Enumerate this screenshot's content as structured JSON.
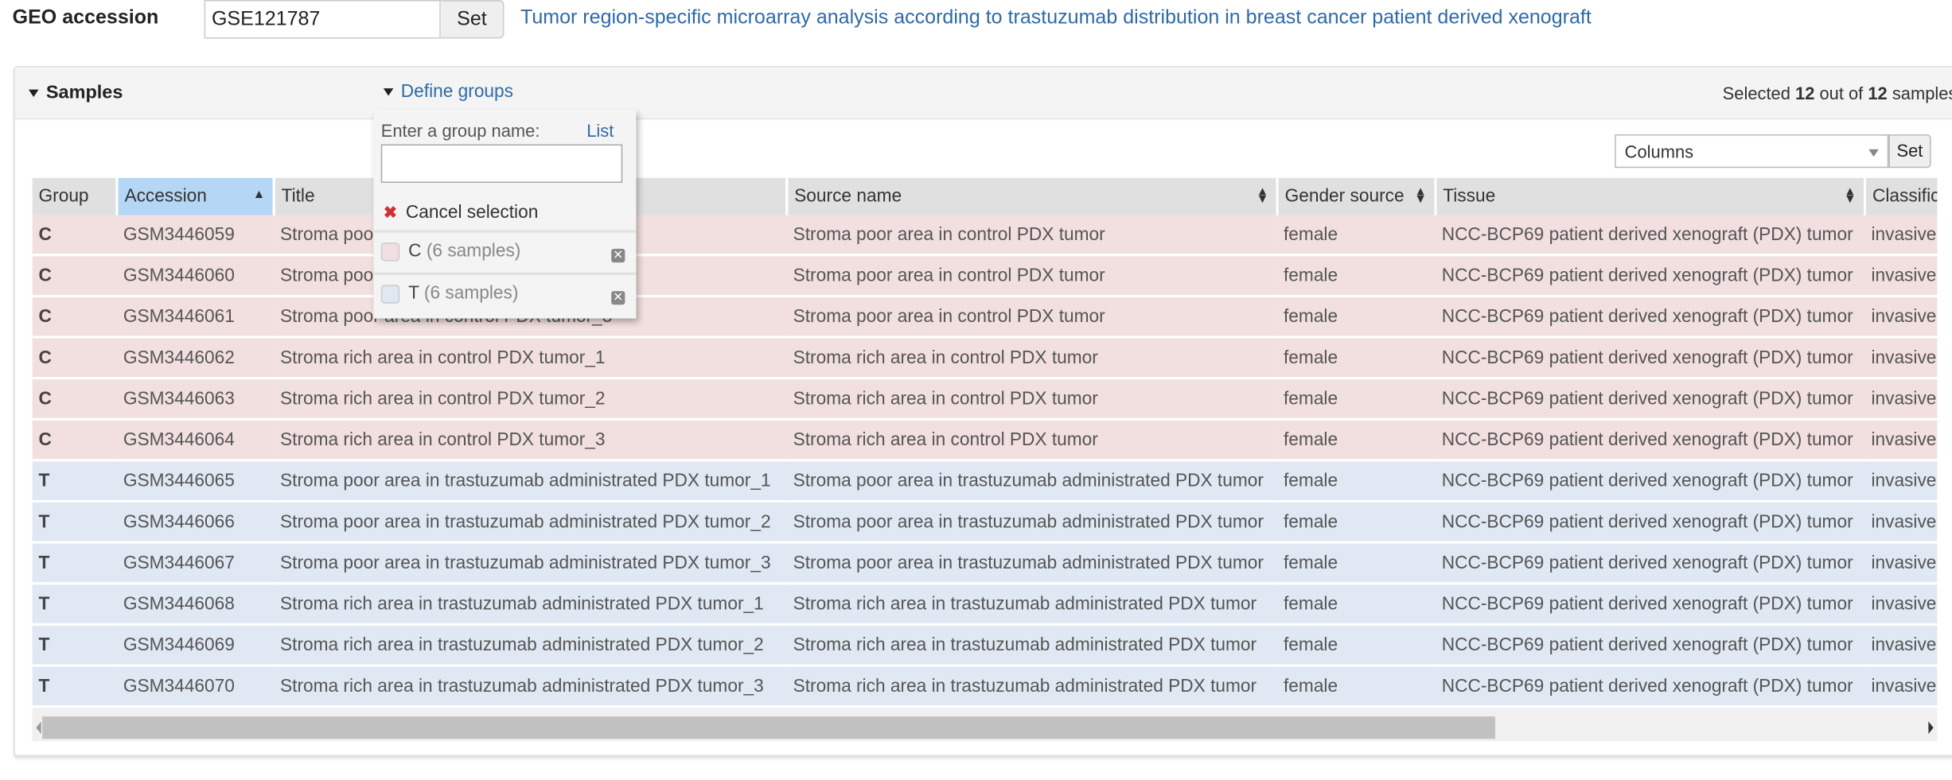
{
  "header": {
    "geo_label": "GEO accession",
    "geo_value": "GSE121787",
    "set_label": "Set",
    "series_title": "Tumor region-specific microarray analysis according to trastuzumab distribution in breast cancer patient derived xenograft"
  },
  "samples_panel": {
    "title": "Samples",
    "define_groups": "Define groups",
    "selected_prefix": "Selected",
    "selected_count": "12",
    "selected_mid": "out of",
    "total_count": "12",
    "selected_suffix": "samples",
    "columns_select": "Columns",
    "columns_set": "Set"
  },
  "groups_popup": {
    "prompt": "Enter a group name:",
    "list_link": "List",
    "input_value": "",
    "cancel_label": "Cancel selection",
    "groups": [
      {
        "name": "C",
        "count": "(6 samples)",
        "color": "#f2dfdf"
      },
      {
        "name": "T",
        "count": "(6 samples)",
        "color": "#dfe8f3"
      }
    ]
  },
  "table": {
    "columns": [
      "Group",
      "Accession",
      "Title",
      "Source name",
      "Gender source",
      "Tissue",
      "Classification"
    ],
    "sorted_column": "Accession",
    "rows": [
      [
        "C",
        "GSM3446059",
        "Stroma poor area in control PDX tumor_1",
        "Stroma poor area in control PDX tumor",
        "female",
        "NCC-BCP69 patient derived xenograft (PDX) tumor",
        "invasive"
      ],
      [
        "C",
        "GSM3446060",
        "Stroma poor area in control PDX tumor_2",
        "Stroma poor area in control PDX tumor",
        "female",
        "NCC-BCP69 patient derived xenograft (PDX) tumor",
        "invasive"
      ],
      [
        "C",
        "GSM3446061",
        "Stroma poor area in control PDX tumor_3",
        "Stroma poor area in control PDX tumor",
        "female",
        "NCC-BCP69 patient derived xenograft (PDX) tumor",
        "invasive"
      ],
      [
        "C",
        "GSM3446062",
        "Stroma rich area in control PDX tumor_1",
        "Stroma rich area in control PDX tumor",
        "female",
        "NCC-BCP69 patient derived xenograft (PDX) tumor",
        "invasive"
      ],
      [
        "C",
        "GSM3446063",
        "Stroma rich area in control PDX tumor_2",
        "Stroma rich area in control PDX tumor",
        "female",
        "NCC-BCP69 patient derived xenograft (PDX) tumor",
        "invasive"
      ],
      [
        "C",
        "GSM3446064",
        "Stroma rich area in control PDX tumor_3",
        "Stroma rich area in control PDX tumor",
        "female",
        "NCC-BCP69 patient derived xenograft (PDX) tumor",
        "invasive"
      ],
      [
        "T",
        "GSM3446065",
        "Stroma poor area in trastuzumab administrated PDX tumor_1",
        "Stroma poor area in trastuzumab administrated PDX tumor",
        "female",
        "NCC-BCP69 patient derived xenograft (PDX) tumor",
        "invasive"
      ],
      [
        "T",
        "GSM3446066",
        "Stroma poor area in trastuzumab administrated PDX tumor_2",
        "Stroma poor area in trastuzumab administrated PDX tumor",
        "female",
        "NCC-BCP69 patient derived xenograft (PDX) tumor",
        "invasive"
      ],
      [
        "T",
        "GSM3446067",
        "Stroma poor area in trastuzumab administrated PDX tumor_3",
        "Stroma poor area in trastuzumab administrated PDX tumor",
        "female",
        "NCC-BCP69 patient derived xenograft (PDX) tumor",
        "invasive"
      ],
      [
        "T",
        "GSM3446068",
        "Stroma rich area in trastuzumab administrated PDX tumor_1",
        "Stroma rich area in trastuzumab administrated PDX tumor",
        "female",
        "NCC-BCP69 patient derived xenograft (PDX) tumor",
        "invasive"
      ],
      [
        "T",
        "GSM3446069",
        "Stroma rich area in trastuzumab administrated PDX tumor_2",
        "Stroma rich area in trastuzumab administrated PDX tumor",
        "female",
        "NCC-BCP69 patient derived xenograft (PDX) tumor",
        "invasive"
      ],
      [
        "T",
        "GSM3446070",
        "Stroma rich area in trastuzumab administrated PDX tumor_3",
        "Stroma rich area in trastuzumab administrated PDX tumor",
        "female",
        "NCC-BCP69 patient derived xenograft (PDX) tumor",
        "invasive"
      ]
    ]
  }
}
